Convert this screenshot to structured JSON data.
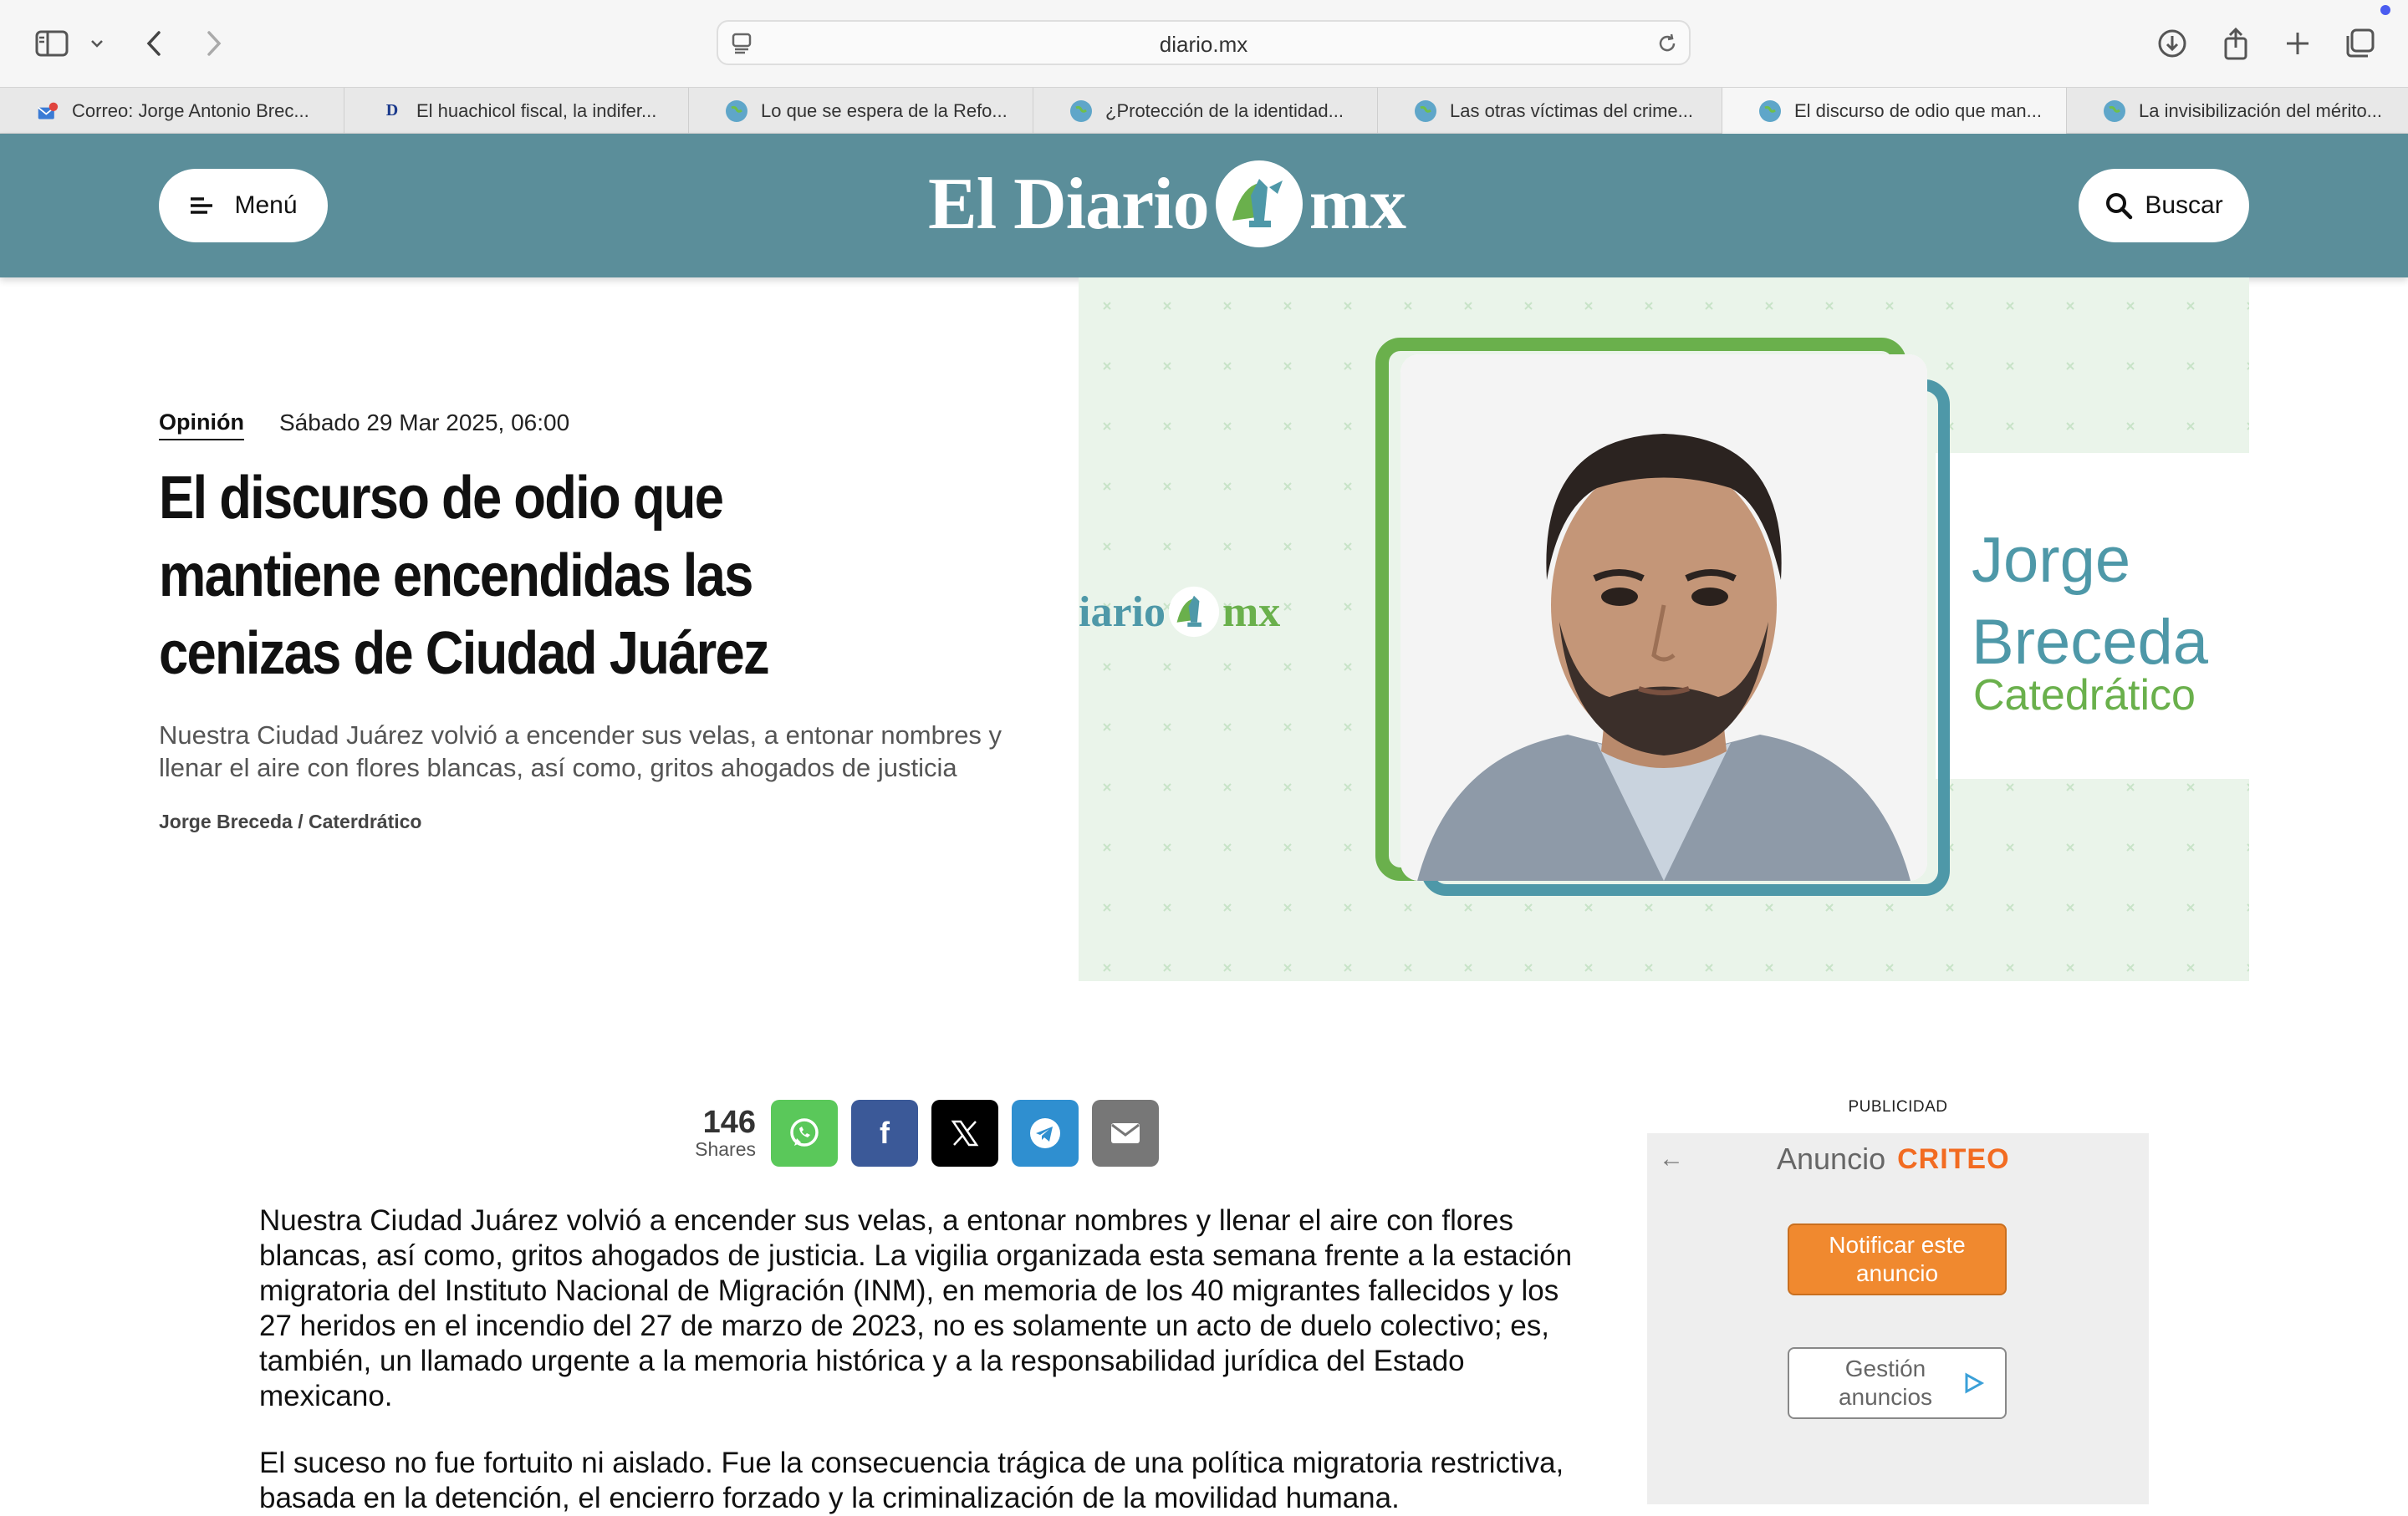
{
  "browser": {
    "url": "diario.mx",
    "tabs": [
      {
        "title": "Correo: Jorge Antonio Brec...",
        "favicon": "mail-icon",
        "active": false
      },
      {
        "title": "El huachicol fiscal, la indifer...",
        "favicon": "letter-d-icon",
        "active": false
      },
      {
        "title": "Lo que se espera de la Refo...",
        "favicon": "globe-icon",
        "active": false
      },
      {
        "title": "¿Protección de la identidad...",
        "favicon": "globe-icon",
        "active": false
      },
      {
        "title": "Las otras víctimas del crime...",
        "favicon": "globe-icon",
        "active": false
      },
      {
        "title": "El discurso de odio que man...",
        "favicon": "globe-icon",
        "active": true
      },
      {
        "title": "La invisibilización del mérito...",
        "favicon": "globe-icon",
        "active": false
      }
    ],
    "favicon_letter": "D"
  },
  "header": {
    "menu_label": "Menú",
    "logo_left": "El Diario",
    "logo_right": "mx",
    "search_label": "Buscar",
    "bg_color": "#5b8e9a"
  },
  "article": {
    "section": "Opinión",
    "date": "Sábado 29 Mar 2025, 06:00",
    "title": "El discurso de odio que mantiene encendidas las cenizas de Ciudad Juárez",
    "subtitle": "Nuestra Ciudad Juárez volvió a encender sus velas, a entonar nombres y llenar el aire con flores blancas, así como, gritos ahogados de justicia",
    "byline": "Jorge Breceda / Caterdrático",
    "image": {
      "logo_left": "iario",
      "logo_right": "mx",
      "name_first": "Jorge",
      "name_last": "Breceda",
      "role": "Catedrático"
    },
    "shares": {
      "count": "146",
      "label": "Shares"
    },
    "share_buttons": [
      {
        "name": "whatsapp",
        "color": "#5ac85a"
      },
      {
        "name": "facebook",
        "color": "#3b5998"
      },
      {
        "name": "x",
        "color": "#000000"
      },
      {
        "name": "telegram",
        "color": "#2f8fd0"
      },
      {
        "name": "email",
        "color": "#777777"
      }
    ],
    "paragraphs": [
      "Nuestra Ciudad Juárez volvió a encender sus velas, a entonar nombres y llenar el aire con flores blancas, así como, gritos ahogados de justicia. La vigilia organizada esta semana frente a la estación migratoria del Instituto Nacional de Migración (INM), en memoria de los 40 migrantes fallecidos y los 27 heridos en el incendio del 27 de marzo de 2023, no es solamente un acto de duelo colectivo; es, también, un llamado urgente a la memoria histórica y a la responsabilidad jurídica del Estado mexicano.",
      "El suceso no fue fortuito ni aislado. Fue la consecuencia trágica de una política migratoria restrictiva, basada en la detención, el encierro forzado y la criminalización de la movilidad humana."
    ]
  },
  "ad": {
    "label": "PUBLICIDAD",
    "anuncio": "Anuncio",
    "brand": "CRITEO",
    "notify_label": "Notificar este anuncio",
    "manage_label": "Gestión anuncios"
  }
}
